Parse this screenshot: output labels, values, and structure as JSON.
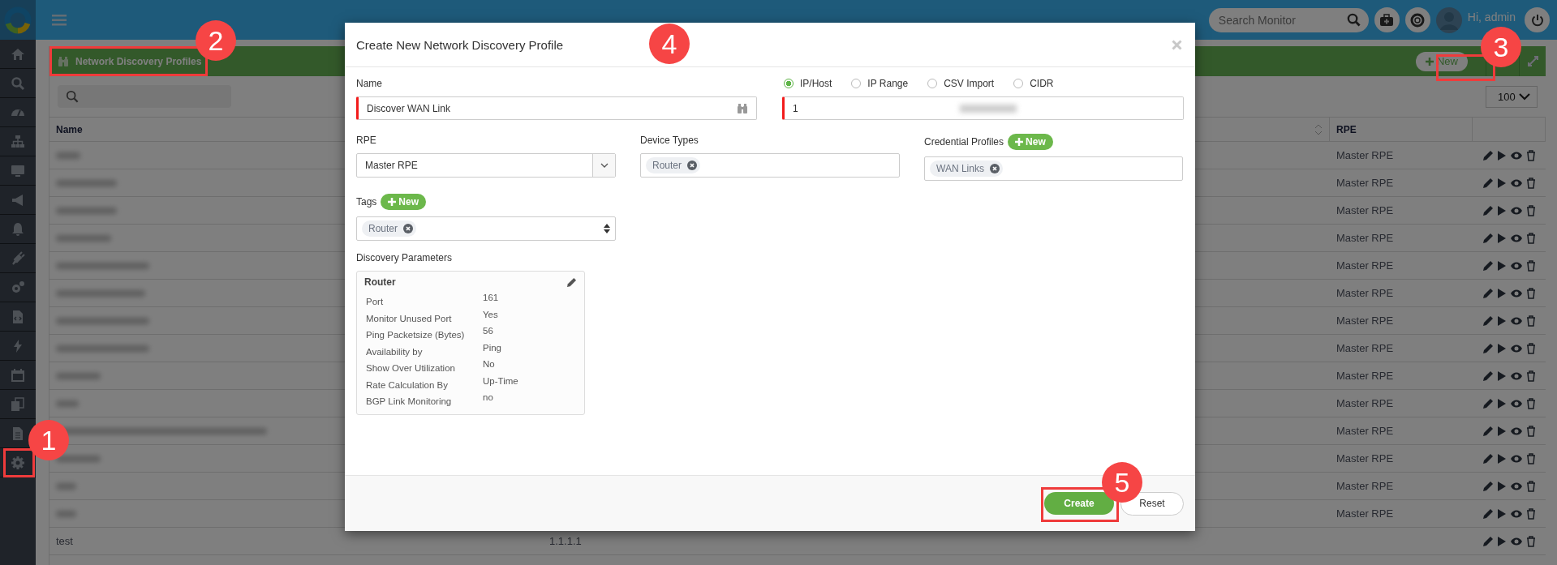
{
  "topbar": {
    "search_placeholder": "Search Monitor",
    "greeting": "Hi, admin"
  },
  "panel": {
    "title": "Network Discovery Profiles",
    "new_button": "New",
    "page_size": "100",
    "name_column": "Name",
    "rpe_column": "RPE",
    "rows": [
      {
        "rpe": "Master RPE"
      },
      {
        "rpe": "Master RPE"
      },
      {
        "rpe": "Master RPE"
      },
      {
        "rpe": "Master RPE"
      },
      {
        "rpe": "Master RPE"
      },
      {
        "rpe": "Master RPE"
      },
      {
        "rpe": "Master RPE"
      },
      {
        "rpe": "Master RPE"
      },
      {
        "rpe": "Master RPE"
      },
      {
        "rpe": "Master RPE"
      },
      {
        "rpe": "Master RPE"
      },
      {
        "rpe": "Master RPE"
      },
      {
        "rpe": "Master RPE"
      },
      {
        "rpe": "Master RPE"
      },
      {
        "name": "test",
        "column_2": "1.1.1.1"
      }
    ]
  },
  "dialog": {
    "title": "Create New Network Discovery Profile",
    "name_field": {
      "label": "Name",
      "value": "Discover WAN Link",
      "required": true
    },
    "address_modes": [
      {
        "label": "IP/Host",
        "selected": true
      },
      {
        "label": "IP Range",
        "selected": false
      },
      {
        "label": "CSV Import",
        "selected": false
      },
      {
        "label": "CIDR",
        "selected": false
      }
    ],
    "address_field": {
      "value": "1",
      "required": true
    },
    "rpe": {
      "label": "RPE",
      "value": "Master RPE"
    },
    "device_types": {
      "label": "Device Types",
      "tags": [
        "Router"
      ]
    },
    "credential_profiles": {
      "label": "Credential Profiles",
      "new_button": "New",
      "tags": [
        "WAN Links"
      ]
    },
    "tags": {
      "label": "Tags",
      "new_button": "New",
      "tags": [
        "Router"
      ]
    },
    "parameters": {
      "label": "Discovery Parameters",
      "card_title": "Router",
      "rows": [
        {
          "label": "Port",
          "value": "161"
        },
        {
          "label": "Monitor Unused Port",
          "value": "Yes"
        },
        {
          "label": "Ping Packetsize (Bytes)",
          "value": "56"
        },
        {
          "label": "Availability by",
          "value": "Ping"
        },
        {
          "label": "Show Over Utilization",
          "value": "No"
        },
        {
          "label": "Rate Calculation By",
          "value": "Up-Time"
        },
        {
          "label": "BGP Link Monitoring",
          "value": "no"
        }
      ]
    },
    "create_button": "Create",
    "reset_button": "Reset"
  },
  "annotations": [
    {
      "label": "2",
      "boxed": true
    },
    {
      "label": "4",
      "boxed": false
    },
    {
      "label": "3",
      "boxed": true
    },
    {
      "label": "1",
      "boxed": true
    },
    {
      "label": "5",
      "boxed": true
    }
  ]
}
